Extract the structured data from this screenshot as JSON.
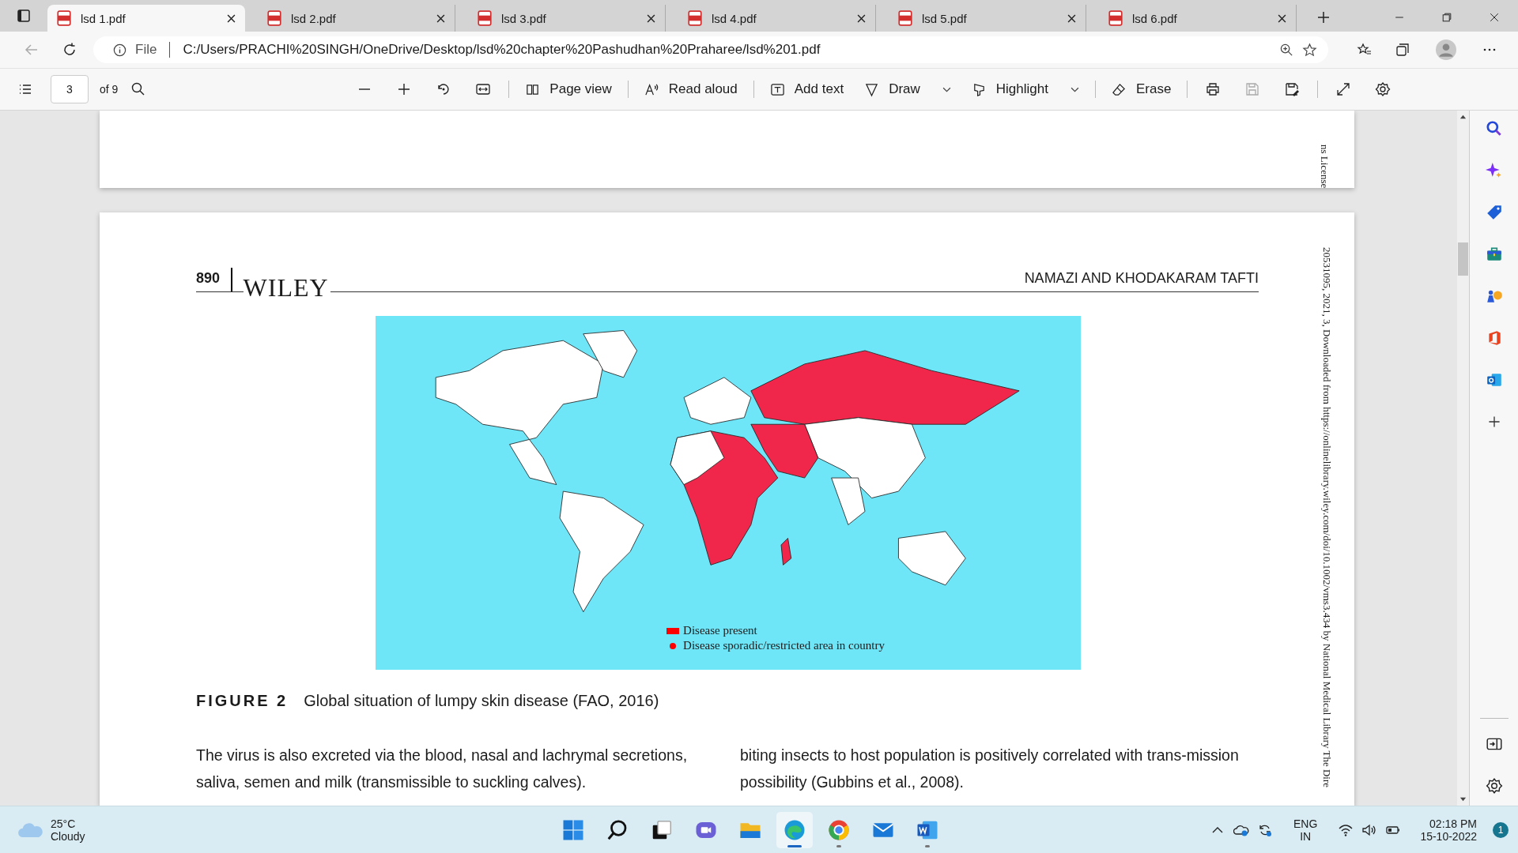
{
  "tabs": [
    {
      "label": "lsd 1.pdf",
      "selected": true
    },
    {
      "label": "lsd 2.pdf",
      "selected": false
    },
    {
      "label": "lsd 3.pdf",
      "selected": false
    },
    {
      "label": "lsd 4.pdf",
      "selected": false
    },
    {
      "label": "lsd 5.pdf",
      "selected": false
    },
    {
      "label": "lsd 6.pdf",
      "selected": false
    }
  ],
  "address_bar": {
    "scheme": "File",
    "url": "C:/Users/PRACHI%20SINGH/OneDrive/Desktop/lsd%20chapter%20Pashudhan%20Praharee/lsd%201.pdf"
  },
  "pdf_toolbar": {
    "page": "3",
    "page_count": "of 9",
    "tools": [
      {
        "label": "Page view",
        "kind": "pageview",
        "dropdown": false
      },
      {
        "label": "Read aloud",
        "kind": "read",
        "dropdown": false
      },
      {
        "label": "Add text",
        "kind": "text",
        "dropdown": false
      },
      {
        "label": "Draw",
        "kind": "draw",
        "dropdown": true
      },
      {
        "label": "Highlight",
        "kind": "highlight",
        "dropdown": true
      },
      {
        "label": "Erase",
        "kind": "erase",
        "dropdown": false
      }
    ]
  },
  "previous_page": {
    "side_note": "ns License"
  },
  "page": {
    "page_number": "890",
    "logo": "WILEY",
    "running_head": "NAMAZI AND KHODAKARAM TAFTI",
    "figure": {
      "legend": [
        {
          "label": "Disease present",
          "kind": "square"
        },
        {
          "label": "Disease sporadic/restricted area in country",
          "kind": "dot"
        }
      ],
      "caption_label": "FIGURE 2",
      "caption": "Global situation of lumpy skin disease (FAO, 2016)"
    },
    "columns": [
      "The virus is also excreted via the blood, nasal and lachrymal secretions, saliva, semen and milk (transmissible to suckling calves).",
      "biting insects to host population is positively correlated with trans-mission possibility (Gubbins et al., 2008)."
    ],
    "side_note": "20531095, 2021, 3, Downloaded from https://onlinelibrary.wiley.com/doi/10.1002/vms3.434 by National Medical Library The Dire"
  },
  "taskbar": {
    "temperature": "25°C",
    "condition": "Cloudy",
    "apps": [
      {
        "kind": "start",
        "open": false,
        "selected": false
      },
      {
        "kind": "search",
        "open": false,
        "selected": false
      },
      {
        "kind": "taskview",
        "open": false,
        "selected": false
      },
      {
        "kind": "chat",
        "open": false,
        "selected": false
      },
      {
        "kind": "explorer",
        "open": false,
        "selected": false
      },
      {
        "kind": "edge",
        "open": true,
        "selected": true
      },
      {
        "kind": "chrome",
        "open": true,
        "selected": false
      },
      {
        "kind": "mail",
        "open": false,
        "selected": false
      },
      {
        "kind": "word",
        "open": true,
        "selected": false
      }
    ],
    "language": "ENG",
    "region": "IN",
    "time": "02:18 PM",
    "date": "15-10-2022",
    "notifications": "1"
  }
}
